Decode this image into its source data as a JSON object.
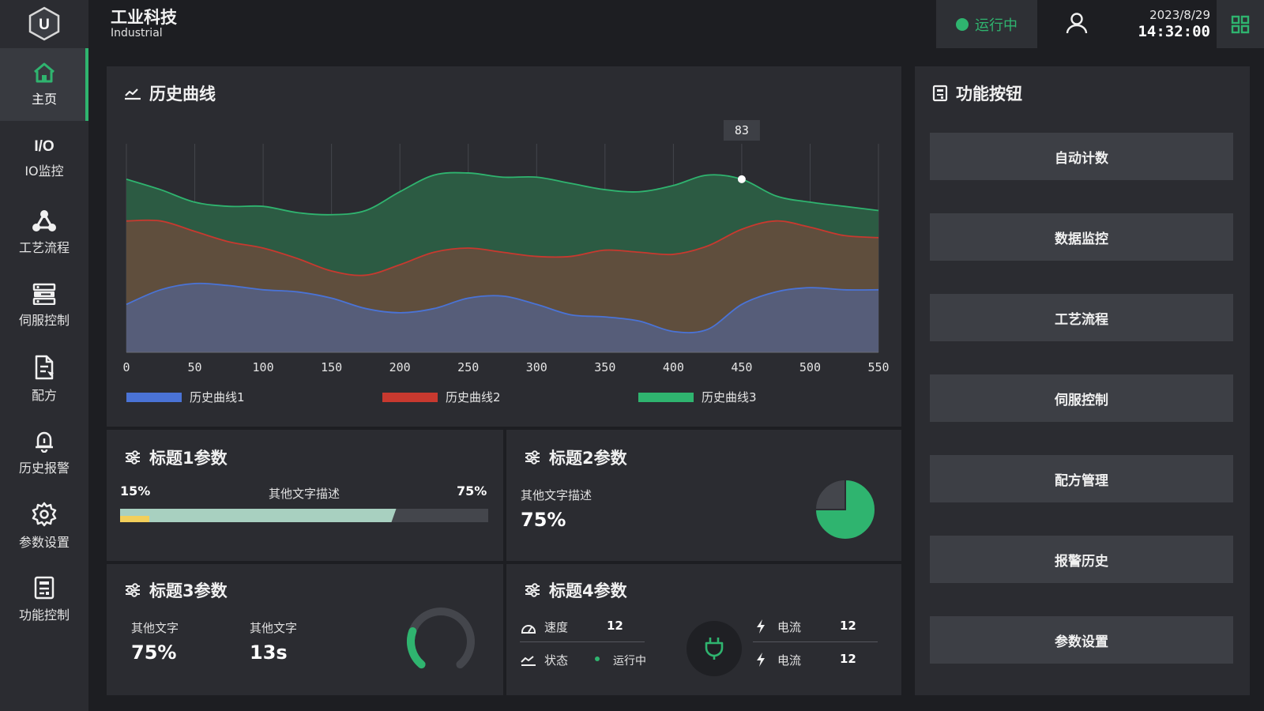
{
  "logo": {
    "letter": "U"
  },
  "header": {
    "title": "工业科技",
    "subtitle": "Industrial"
  },
  "status": {
    "text": "运行中",
    "color": "#2fb46f"
  },
  "datetime": {
    "date": "2023/8/29",
    "time": "14:32:00"
  },
  "sidebar": {
    "items": [
      {
        "label": "主页",
        "icon": "home-icon",
        "active": true
      },
      {
        "label": "IO监控",
        "icon": "io-icon",
        "icon_text": "I/O"
      },
      {
        "label": "工艺流程",
        "icon": "process-flow-icon"
      },
      {
        "label": "伺服控制",
        "icon": "servo-icon"
      },
      {
        "label": "配方",
        "icon": "recipe-icon"
      },
      {
        "label": "历史报警",
        "icon": "bell-icon"
      },
      {
        "label": "参数设置",
        "icon": "gear-icon"
      },
      {
        "label": "功能控制",
        "icon": "function-control-icon"
      }
    ]
  },
  "history_panel": {
    "title": "历史曲线"
  },
  "chart_data": {
    "type": "area",
    "x": [
      0,
      25,
      50,
      75,
      100,
      125,
      150,
      175,
      200,
      225,
      250,
      275,
      300,
      325,
      350,
      375,
      400,
      425,
      450,
      475,
      500,
      525,
      550
    ],
    "xticks": [
      0,
      50,
      100,
      150,
      200,
      250,
      300,
      350,
      400,
      450,
      500,
      550
    ],
    "ylim": [
      0,
      100
    ],
    "series": [
      {
        "name": "历史曲线1",
        "color": "#4a73d6",
        "values": [
          23,
          30,
          33,
          32,
          30,
          29,
          26,
          21,
          19,
          21,
          26,
          27,
          23,
          18,
          17,
          15,
          10,
          11,
          23,
          29,
          31,
          30,
          30
        ]
      },
      {
        "name": "历史曲线2",
        "color": "#c8392f",
        "values": [
          63,
          63,
          58,
          53,
          50,
          45,
          39,
          37,
          42,
          48,
          50,
          48,
          46,
          46,
          49,
          48,
          47,
          51,
          59,
          63,
          60,
          56,
          55
        ]
      },
      {
        "name": "历史曲线3",
        "color": "#2fb46f",
        "values": [
          83,
          78,
          72,
          70,
          70,
          67,
          66,
          68,
          77,
          85,
          86,
          84,
          84,
          81,
          78,
          77,
          80,
          85,
          83,
          75,
          72,
          70,
          68
        ]
      }
    ],
    "tooltip": {
      "x": 450,
      "value": "83"
    }
  },
  "param1": {
    "title": "标题1参数",
    "left_pct": "15%",
    "center_text": "其他文字描述",
    "right_pct": "75%",
    "bar_yellow": 0.08,
    "bar_green": 0.75
  },
  "param2": {
    "title": "标题2参数",
    "desc": "其他文字描述",
    "value": "75%",
    "pie_fraction": 0.75
  },
  "param3": {
    "title": "标题3参数",
    "label1": "其他文字",
    "value1": "75%",
    "label2": "其他文字",
    "value2": "13s",
    "gauge_fraction": 0.25
  },
  "param4": {
    "title": "标题4参数",
    "speed_label": "速度",
    "speed_value": "12",
    "state_label": "状态",
    "state_value": "运行中",
    "current1_label": "电流",
    "current1_value": "12",
    "current2_label": "电流",
    "current2_value": "12"
  },
  "function_panel": {
    "title": "功能按钮",
    "buttons": [
      "自动计数",
      "数据监控",
      "工艺流程",
      "伺服控制",
      "配方管理",
      "报警历史",
      "参数设置"
    ]
  }
}
